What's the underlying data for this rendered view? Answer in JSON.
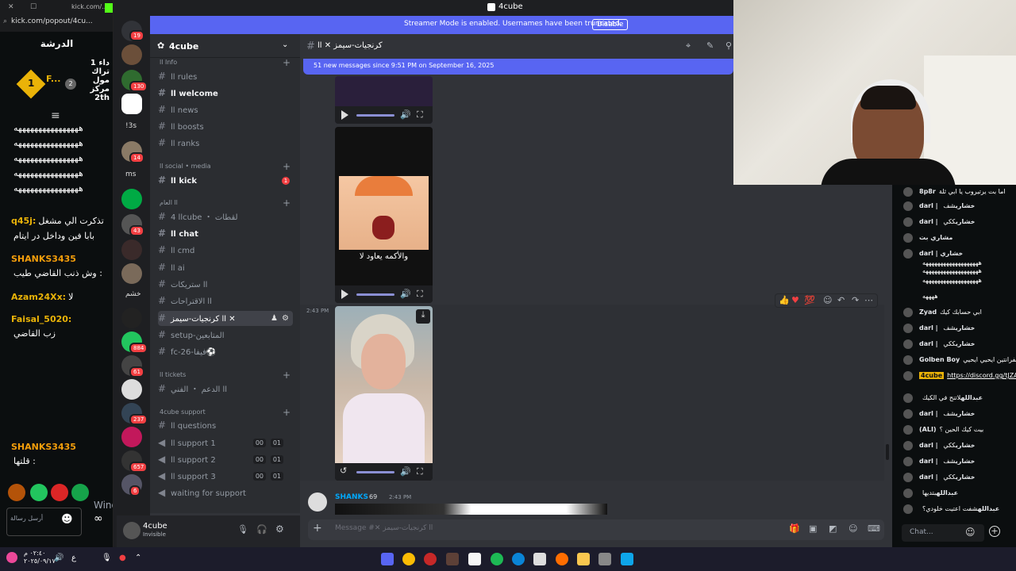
{
  "window_title": "4cube",
  "kick": {
    "tab_title": "kick.com/...",
    "url": "kick.com/popout/4cu...",
    "stream_title": "الدرشة",
    "leader_name": "F...",
    "leader_text": "داء 1 تراك مول مركز 2th",
    "lines": [
      {
        "name": "",
        "text": "ههههههههههههههههه"
      },
      {
        "name": "",
        "text": "ههههههههههههههههه"
      },
      {
        "name": "",
        "text": "ههههههههههههههههه"
      },
      {
        "name": "",
        "text": "ههههههههههههههههه"
      },
      {
        "name": "",
        "text": "ههههههههههههههههه"
      },
      {
        "name": "q45j:",
        "text": "تذكرت الي مشغل"
      },
      {
        "name": "",
        "text": "بابا فين وداخل در ايتام"
      },
      {
        "name": "SHANKS3435",
        "text": ""
      },
      {
        "name": "",
        "text": "وش ذنب القاضي طيب :"
      },
      {
        "name": "Azam24Xx:",
        "text": "لا"
      },
      {
        "name": "Faisal_5020:",
        "text": ""
      },
      {
        "name": "",
        "text": "زب القاضي"
      },
      {
        "name": "SHANKS3435",
        "text": ""
      },
      {
        "name": "",
        "text": "قلتها :"
      }
    ],
    "watermark_line1": "Windows تنشيط",
    "watermark_line2": "انتقل إلى الإعدادات لتنشيط Windows.",
    "send_label": "أرسل رسالة"
  },
  "streamer_banner": {
    "message": "Streamer Mode is enabled. Usernames have been truncated.",
    "button": "Disable"
  },
  "server": {
    "name": "4cube",
    "rail_badges": [
      "19",
      "130",
      "14",
      "43",
      "884",
      "61",
      "237",
      "657",
      "6"
    ],
    "rail_labels": [
      "!3s",
      "ms",
      "خشم"
    ]
  },
  "channels": {
    "categories": {
      "info": "اا Info",
      "social": "اا social • media",
      "general": "اا العام",
      "tickets": "اا tickets",
      "support": "4cube support"
    },
    "info_items": [
      "اا rules",
      "اا welcome",
      "اا news",
      "اا boosts",
      "اا ranks"
    ],
    "social_items": [
      "اا kick"
    ],
    "kick_badge": "1",
    "general_items": [
      "اا 4cube ・ لقطات",
      "اا chat",
      "اا cmd",
      "اا ai",
      "اا ستريكات",
      "اا الاقتراحات",
      "اا كرنجيات-سيمز ✕",
      "setup-المتابعين",
      "fc-26-فيفا⚽"
    ],
    "tickets_items": [
      "اا الدعم ・ الفني"
    ],
    "support_items": [
      "اا questions",
      "اا support 1",
      "اا support 2",
      "اا support 3",
      "waiting for support"
    ],
    "support_counts": [
      "00",
      "01"
    ]
  },
  "user": {
    "name": "4cube",
    "status": "Invisible"
  },
  "chat": {
    "channel_title": "كرنجيات-سيمز ✕ اا",
    "new_messages": "51 new messages since 9:51 PM on September 16, 2025",
    "timestamp": "2:43 PM",
    "video_caption": "والأكمه يعاود لا",
    "author": "SHANKS",
    "author_time": "2:43 PM",
    "author_badge": "69",
    "composer_placeholder": "Message #✕ اا كرنجيات-سيمز"
  },
  "right_chat": {
    "lines": [
      {
        "name": "8p8r",
        "text": "اما بت يرتيروب يا ابي ثلة"
      },
      {
        "name": "darl | خشاري",
        "text": "شف"
      },
      {
        "name": "darl | خشاري",
        "text": "ككي"
      },
      {
        "name": "مشاري بت",
        "text": ""
      },
      {
        "name": "darl | خشاري",
        "text": ""
      },
      {
        "name": "",
        "text": "هههههههههههههههههههه"
      },
      {
        "name": "",
        "text": "هههههههههههههههههههه"
      },
      {
        "name": "",
        "text": "هههههههههههههههههههه"
      },
      {
        "name": "",
        "text": "ههههه"
      },
      {
        "name": "Zyad",
        "text": "ابي حسابك كيك"
      },
      {
        "name": "darl | خشاري",
        "text": "شف"
      },
      {
        "name": "darl | خشاري",
        "text": "ككي"
      },
      {
        "name": "Golben Boy",
        "text": "الفرانتين ايحيي ايحيي"
      },
      {
        "name": "4cube",
        "text": "https://discord.gg/tJZA Sz4c"
      },
      {
        "name": "عبدالله",
        "text": "لاتنح في الكيك"
      },
      {
        "name": "darl | خشاري",
        "text": "شف"
      },
      {
        "name": "(ALI)",
        "text": "بيت كيك الحين ؟"
      },
      {
        "name": "darl | خشاري",
        "text": "ككي"
      },
      {
        "name": "darl | خشاري",
        "text": "شف"
      },
      {
        "name": "darl | خشاري",
        "text": "ككي"
      },
      {
        "name": "عبدالله",
        "text": "بتديها"
      },
      {
        "name": "عبدالله",
        "text": "شفت اعتيت خلودي؟"
      }
    ],
    "input_placeholder": "Chat..."
  },
  "taskbar": {
    "time": "٠٢:٤٠ م",
    "date": "٢٠٢٥/٠٩/١٧"
  },
  "colors": {
    "blurple": "#5865f2",
    "kick_green": "#53fc18",
    "discord_bg": "#313338",
    "sidebar_bg": "#2b2d31",
    "rail_bg": "#1e1f22"
  }
}
